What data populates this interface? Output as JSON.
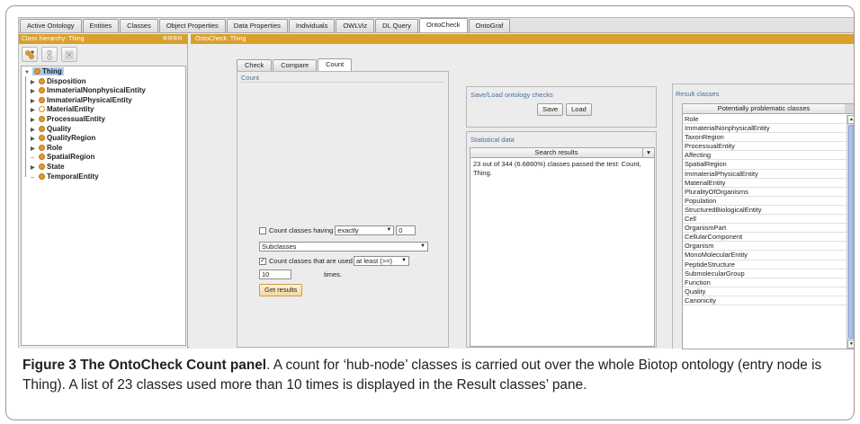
{
  "top_tabs": [
    "Active Ontology",
    "Entities",
    "Classes",
    "Object Properties",
    "Data Properties",
    "Individuals",
    "OWLViz",
    "DL Query",
    "OntoCheck",
    "OntoGraf"
  ],
  "active_top_tab": "OntoCheck",
  "left_panel": {
    "title": "Class hierarchy: Thing",
    "controls": "⊞⊟⊞⊟",
    "toolbar": [
      "add-subclass-icon",
      "add-sibling-icon",
      "delete-class-icon"
    ]
  },
  "right_panel": {
    "title": "OntoCheck: Thing"
  },
  "tree": {
    "root": "Thing",
    "children": [
      {
        "label": "Disposition",
        "expandable": true,
        "hollow": false
      },
      {
        "label": "ImmaterialNonphysicalEntity",
        "expandable": true,
        "hollow": false
      },
      {
        "label": "ImmaterialPhysicalEntity",
        "expandable": true,
        "hollow": false
      },
      {
        "label": "MaterialEntity",
        "expandable": true,
        "hollow": true
      },
      {
        "label": "ProcessualEntity",
        "expandable": true,
        "hollow": false
      },
      {
        "label": "Quality",
        "expandable": true,
        "hollow": false
      },
      {
        "label": "QualityRegion",
        "expandable": true,
        "hollow": false
      },
      {
        "label": "Role",
        "expandable": true,
        "hollow": false
      },
      {
        "label": "SpatialRegion",
        "expandable": false,
        "hollow": false
      },
      {
        "label": "State",
        "expandable": true,
        "hollow": false
      },
      {
        "label": "TemporalEntity",
        "expandable": false,
        "hollow": false
      }
    ]
  },
  "check_tabs": [
    "Check",
    "Compare",
    "Count"
  ],
  "active_check_tab": "Count",
  "count": {
    "legend": "Count",
    "having_label": "Count classes having",
    "having_checked": false,
    "having_mode": "exactly",
    "having_value": "0",
    "relation": "Subclasses",
    "used_label": "Count classes that are used",
    "used_checked": true,
    "used_mode": "at least (>=)",
    "times_value": "10",
    "times_label": "times.",
    "get_results": "Get results"
  },
  "save_load": {
    "legend": "Save/Load ontology checks",
    "save": "Save",
    "load": "Load"
  },
  "stats": {
    "legend": "Statistical data",
    "header": "Search results",
    "text": "23 out of 344 (6.6860%) classes passed the test: Count, Thing."
  },
  "results": {
    "legend": "Result classes",
    "header": "Potentially problematic classes",
    "items": [
      "Role",
      "ImmaterialNonphysicalEntity",
      "TaxonRegion",
      "ProcessualEntity",
      "Affecting",
      "SpatialRegion",
      "ImmaterialPhysicalEntity",
      "MaterialEntity",
      "PluralityOfOrganisms",
      "Population",
      "StructuredBiologicalEntity",
      "Cell",
      "OrganismPart",
      "CellularComponent",
      "Organism",
      "MonoMolecularEntity",
      "PeptideStructure",
      "SubmolecularGroup",
      "Function",
      "Quality",
      "Canonicity"
    ]
  },
  "caption": {
    "label": "Figure 3 The OntoCheck Count panel",
    "text": ". A count for ‘hub-node’ classes is carried out over the whole Biotop ontology (entry node is Thing). A list of 23 classes used more than 10 times is displayed in the Result classes’ pane."
  },
  "colors": {
    "accent_bar": "#d9a02b",
    "class_dot": "#e29a2a",
    "selection": "#aecbf0",
    "legend_text": "#4a6ea0"
  }
}
